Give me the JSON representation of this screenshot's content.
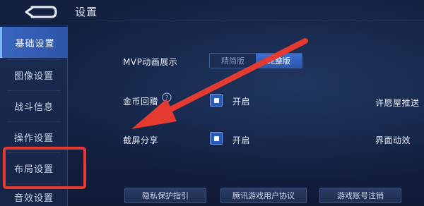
{
  "header": {
    "title": "设置"
  },
  "sidebar": {
    "items": [
      {
        "label": "基础设置"
      },
      {
        "label": "图像设置"
      },
      {
        "label": "战斗信息"
      },
      {
        "label": "操作设置"
      },
      {
        "label": "布局设置"
      },
      {
        "label": "音效设置"
      }
    ],
    "active_index": 0
  },
  "settings": {
    "mvp": {
      "label": "MVP动画展示",
      "options": [
        "精简版",
        "完整版"
      ],
      "selected": "完整版"
    },
    "coin_gift": {
      "label": "金币回赠",
      "checkbox_label": "开启",
      "checked": true
    },
    "wish_push": {
      "label": "许愿屋推送"
    },
    "screenshot_share": {
      "label": "截屏分享",
      "checkbox_label": "开启",
      "checked": true
    },
    "ui_animation": {
      "label": "界面动效"
    }
  },
  "footer": {
    "buttons": [
      {
        "label": "隐私保护指引"
      },
      {
        "label": "腾讯游戏用户协议"
      },
      {
        "label": "游戏账号注销"
      }
    ]
  },
  "annotations": {
    "highlight_color": "#e53a30",
    "arrow_color": "#e53a30"
  }
}
